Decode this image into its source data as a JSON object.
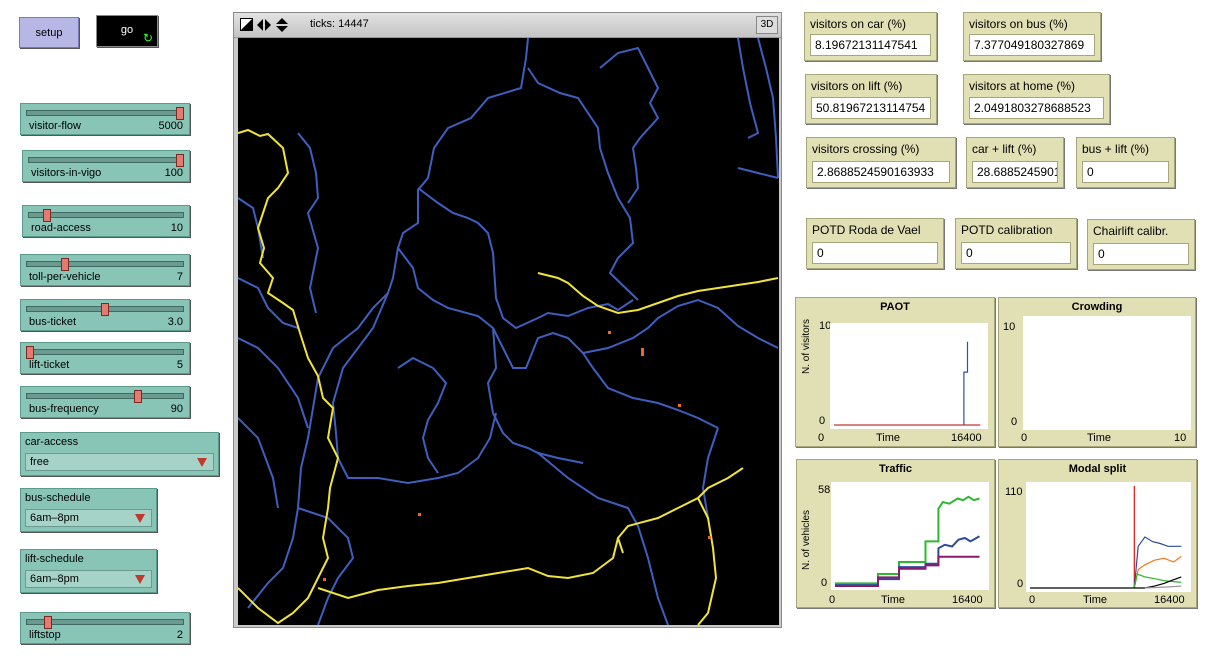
{
  "buttons": {
    "setup": "setup",
    "go": "go",
    "forever_glyph": "↻"
  },
  "sliders": [
    {
      "label": "visitor-flow",
      "value": "5000",
      "fraction": 1.0
    },
    {
      "label": "visitors-in-vigo",
      "value": "100",
      "fraction": 1.0
    },
    {
      "label": "road-access",
      "value": "10",
      "fraction": 0.1
    },
    {
      "label": "toll-per-vehicle",
      "value": "7",
      "fraction": 0.23
    },
    {
      "label": "bus-ticket",
      "value": "3.0",
      "fraction": 0.5
    },
    {
      "label": "lift-ticket",
      "value": "5",
      "fraction": 0.0
    },
    {
      "label": "bus-frequency",
      "value": "90",
      "fraction": 0.72
    },
    {
      "label": "liftstop",
      "value": "2",
      "fraction": 0.12
    }
  ],
  "choosers": [
    {
      "label": "car-access",
      "value": "free"
    },
    {
      "label": "bus-schedule",
      "value": "6am–8pm"
    },
    {
      "label": "lift-schedule",
      "value": "6am–8pm"
    }
  ],
  "view": {
    "ticks": "ticks: 14447",
    "btn3d": "3D"
  },
  "monitors": [
    {
      "label": "visitors on car (%)",
      "value": "8.19672131147541"
    },
    {
      "label": "visitors on bus (%)",
      "value": "7.377049180327869"
    },
    {
      "label": "visitors on lift (%)",
      "value": "50.81967213114754"
    },
    {
      "label": "visitors at home (%)",
      "value": "2.0491803278688523"
    },
    {
      "label": "visitors crossing (%)",
      "value": "2.8688524590163933"
    },
    {
      "label": "car + lift (%)",
      "value": "28.68852459016393"
    },
    {
      "label": "bus + lift (%)",
      "value": "0"
    },
    {
      "label": "POTD Roda de Vael",
      "value": "0"
    },
    {
      "label": "POTD calibration",
      "value": "0"
    },
    {
      "label": "Chairlift calibr.",
      "value": "0"
    }
  ],
  "colors": {
    "road_blue": "#3f5fbf",
    "road_yellow": "#f0e43a",
    "agent_orange": "#e56b2a"
  },
  "chart_data": [
    {
      "type": "line",
      "title": "PAOT",
      "ylabel": "N. of visitors",
      "xlabel": "Time",
      "xlim": [
        0,
        16400
      ],
      "ylim": [
        0,
        10
      ],
      "series": [
        {
          "color": "#c0392b",
          "points": [
            [
              0,
              0
            ],
            [
              16000,
              0
            ]
          ]
        },
        {
          "color": "#3050a0",
          "points": [
            [
              14200,
              0
            ],
            [
              14200,
              5.4
            ],
            [
              14600,
              5.4
            ],
            [
              14600,
              8.5
            ]
          ]
        }
      ]
    },
    {
      "type": "line",
      "title": "Crowding",
      "ylabel": "",
      "xlabel": "Time",
      "xlim": [
        0,
        10
      ],
      "ylim": [
        0,
        10
      ],
      "series": []
    },
    {
      "type": "line",
      "title": "Traffic",
      "ylabel": "N. of vehicles",
      "xlabel": "Time",
      "xlim": [
        0,
        16400
      ],
      "ylim": [
        0,
        58.3
      ],
      "series": [
        {
          "color": "#2eb82e",
          "points": [
            [
              0,
              1.5
            ],
            [
              4700,
              1.5
            ],
            [
              4700,
              7
            ],
            [
              7000,
              7
            ],
            [
              7000,
              14
            ],
            [
              9900,
              14
            ],
            [
              9900,
              26
            ],
            [
              11300,
              26
            ],
            [
              11300,
              45
            ],
            [
              11800,
              49
            ],
            [
              12500,
              48
            ],
            [
              13400,
              51
            ],
            [
              14000,
              50
            ],
            [
              14600,
              52
            ],
            [
              15200,
              50
            ],
            [
              15800,
              51
            ]
          ]
        },
        {
          "color": "#2c4b9a",
          "points": [
            [
              0,
              0.5
            ],
            [
              4700,
              0.5
            ],
            [
              4700,
              4
            ],
            [
              7000,
              4
            ],
            [
              7000,
              11
            ],
            [
              9900,
              11
            ],
            [
              9900,
              13
            ],
            [
              11300,
              13
            ],
            [
              11300,
              22
            ],
            [
              12000,
              24
            ],
            [
              12800,
              23
            ],
            [
              13500,
              27
            ],
            [
              14200,
              28
            ],
            [
              14800,
              26
            ],
            [
              15800,
              29
            ]
          ]
        },
        {
          "color": "#8b1a6b",
          "points": [
            [
              0,
              0
            ],
            [
              4700,
              0
            ],
            [
              4700,
              5
            ],
            [
              7000,
              5
            ],
            [
              7000,
              10
            ],
            [
              9900,
              10
            ],
            [
              9900,
              12
            ],
            [
              11300,
              12
            ],
            [
              11300,
              17
            ],
            [
              15800,
              17
            ]
          ]
        }
      ]
    },
    {
      "type": "line",
      "title": "Modal split",
      "ylabel": "",
      "xlabel": "Time",
      "xlim": [
        0,
        16400
      ],
      "ylim": [
        0,
        110
      ],
      "series": [
        {
          "color": "#e01010",
          "points": [
            [
              10900,
              0
            ],
            [
              10900,
              110
            ]
          ]
        },
        {
          "color": "#2c4b9a",
          "points": [
            [
              10900,
              0
            ],
            [
              11300,
              45
            ],
            [
              12000,
              55
            ],
            [
              12800,
              50
            ],
            [
              13600,
              48
            ],
            [
              14400,
              45
            ],
            [
              15800,
              45
            ]
          ]
        },
        {
          "color": "#f07a1a",
          "points": [
            [
              10900,
              0
            ],
            [
              11300,
              20
            ],
            [
              12000,
              25
            ],
            [
              13000,
              30
            ],
            [
              14000,
              32
            ],
            [
              15000,
              28
            ],
            [
              15800,
              34
            ]
          ]
        },
        {
          "color": "#2eb82e",
          "points": [
            [
              10900,
              0
            ],
            [
              11200,
              15
            ],
            [
              12000,
              12
            ],
            [
              13000,
              10
            ],
            [
              14000,
              8
            ],
            [
              15800,
              6
            ]
          ]
        },
        {
          "color": "#000000",
          "points": [
            [
              0,
              0
            ],
            [
              12000,
              0
            ],
            [
              13000,
              2
            ],
            [
              14000,
              5
            ],
            [
              15000,
              9
            ],
            [
              15800,
              12
            ]
          ]
        },
        {
          "color": "#999999",
          "points": [
            [
              12000,
              0
            ],
            [
              14000,
              1
            ],
            [
              15800,
              2
            ]
          ]
        }
      ]
    }
  ]
}
